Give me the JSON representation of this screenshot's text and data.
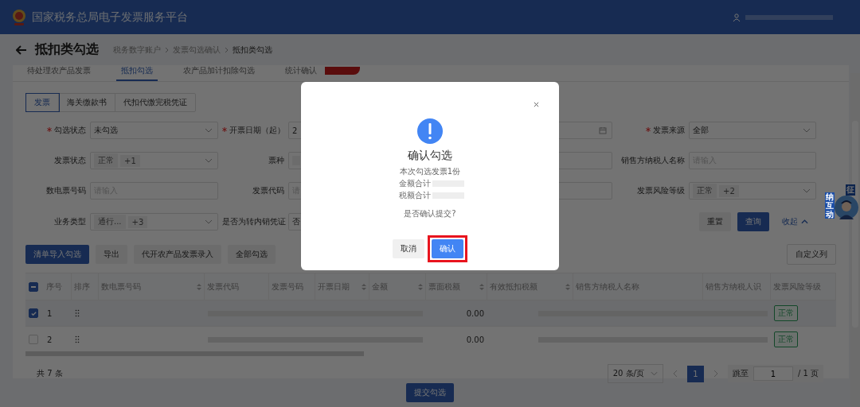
{
  "header": {
    "title": "国家税务总局电子发票服务平台"
  },
  "page": {
    "title": "抵扣类勾选",
    "breadcrumb": [
      "税务数字账户",
      "发票勾选确认",
      "抵扣类勾选"
    ]
  },
  "tabs": [
    {
      "label": "待处理农产品发票",
      "selected": false
    },
    {
      "label": "抵扣勾选",
      "selected": true
    },
    {
      "label": "农产品加计扣除勾选",
      "selected": false
    },
    {
      "label": "统计确认",
      "selected": false
    }
  ],
  "doc_tabs": [
    {
      "label": "发票",
      "selected": true
    },
    {
      "label": "海关缴款书",
      "selected": false
    },
    {
      "label": "代扣代缴完税凭证",
      "selected": false
    }
  ],
  "form_rows": [
    [
      {
        "kind": "select",
        "label": "勾选状态",
        "required": true,
        "value": "未勾选"
      },
      {
        "kind": "input",
        "label": "开票日期（起）",
        "required": true,
        "value": "2"
      },
      {
        "kind": "date_end"
      },
      {
        "kind": "select",
        "label": "发票来源",
        "required": true,
        "value": "全部"
      }
    ],
    [
      {
        "kind": "tags",
        "label": "发票状态",
        "required": false,
        "tags": [
          "正常",
          "+1"
        ]
      },
      {
        "kind": "stub",
        "label": "票种",
        "required": false
      },
      {
        "kind": "plain"
      },
      {
        "kind": "input",
        "label": "销售方纳税人名称",
        "required": false,
        "placeholder": "请输入"
      }
    ],
    [
      {
        "kind": "input",
        "label": "数电票号码",
        "required": false,
        "placeholder": "请输入"
      },
      {
        "kind": "input",
        "label": "发票代码",
        "required": false,
        "placeholder": "请"
      },
      {
        "kind": "plain"
      },
      {
        "kind": "tags",
        "label": "发票风险等级",
        "required": false,
        "tags": [
          "正常",
          "+2"
        ]
      }
    ],
    [
      {
        "kind": "tags",
        "label": "业务类型",
        "required": false,
        "tags": [
          "通行...",
          "+3"
        ]
      },
      {
        "kind": "input",
        "label": "是否为转内销凭证",
        "required": false,
        "value": "否"
      }
    ]
  ],
  "search_actions": [
    {
      "label": "重置",
      "kind": "default"
    },
    {
      "label": "查询",
      "kind": "primary"
    },
    {
      "label": "收起",
      "kind": "link"
    }
  ],
  "toolbar": [
    {
      "label": "清单导入勾选",
      "kind": "primary"
    },
    {
      "label": "导出",
      "kind": "default"
    },
    {
      "label": "代开农产品发票录入",
      "kind": "default"
    },
    {
      "label": "全部勾选",
      "kind": "default"
    }
  ],
  "custom_columns": "自定义列",
  "table": {
    "select_all": {
      "indeterminate": true
    },
    "columns": [
      {
        "label": "序号",
        "sortable": false
      },
      {
        "label": "排序",
        "sortable": false
      },
      {
        "label": "数电票号码",
        "sortable": true
      },
      {
        "label": "发票代码",
        "sortable": false
      },
      {
        "label": "发票号码",
        "sortable": false
      },
      {
        "label": "开票日期",
        "sortable": true
      },
      {
        "label": "金额",
        "sortable": true
      },
      {
        "label": "票面税额",
        "sortable": true
      },
      {
        "label": "有效抵扣税额",
        "sortable": true
      },
      {
        "label": "销售方纳税人名称",
        "sortable": false
      },
      {
        "label": "销售方纳税人识",
        "sortable": false
      },
      {
        "label": "发票风险等级",
        "sortable": false
      }
    ],
    "rows": [
      {
        "selected": true,
        "index": "1",
        "tax": "0.00",
        "risk": "正常"
      },
      {
        "selected": false,
        "index": "2",
        "tax": "0.00",
        "risk": "正常"
      }
    ]
  },
  "pagination": {
    "total": "共 7 条",
    "page_size": "20 条/页",
    "pages": [
      {
        "label": "1",
        "selected": true
      }
    ],
    "jump_label": "跳至",
    "jump_value": "1",
    "page_count": "/ 1 页"
  },
  "submit": "提交勾选",
  "mascot": {
    "top": "征",
    "side": "纳互动"
  },
  "dialog": {
    "title": "确认勾选",
    "summary": "本次勾选发票1份",
    "totals": [
      "金额合计",
      "税额合计"
    ],
    "question": "是否确认提交?",
    "buttons": [
      {
        "label": "取消",
        "kind": "default",
        "highlighted": false
      },
      {
        "label": "确认",
        "kind": "primary",
        "highlighted": true
      }
    ]
  }
}
